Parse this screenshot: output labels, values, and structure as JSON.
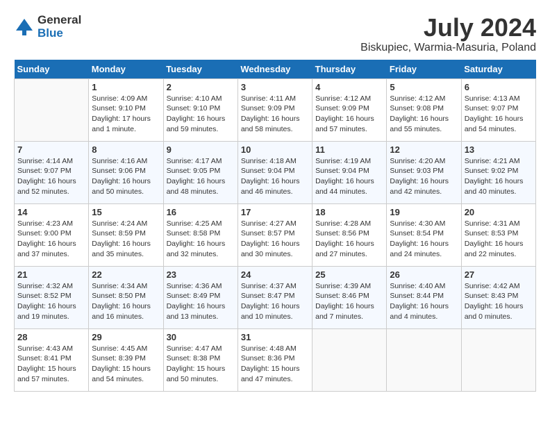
{
  "logo": {
    "text_general": "General",
    "text_blue": "Blue"
  },
  "title": "July 2024",
  "subtitle": "Biskupiec, Warmia-Masuria, Poland",
  "days_header": [
    "Sunday",
    "Monday",
    "Tuesday",
    "Wednesday",
    "Thursday",
    "Friday",
    "Saturday"
  ],
  "weeks": [
    [
      {
        "num": "",
        "info": ""
      },
      {
        "num": "1",
        "info": "Sunrise: 4:09 AM\nSunset: 9:10 PM\nDaylight: 17 hours\nand 1 minute."
      },
      {
        "num": "2",
        "info": "Sunrise: 4:10 AM\nSunset: 9:10 PM\nDaylight: 16 hours\nand 59 minutes."
      },
      {
        "num": "3",
        "info": "Sunrise: 4:11 AM\nSunset: 9:09 PM\nDaylight: 16 hours\nand 58 minutes."
      },
      {
        "num": "4",
        "info": "Sunrise: 4:12 AM\nSunset: 9:09 PM\nDaylight: 16 hours\nand 57 minutes."
      },
      {
        "num": "5",
        "info": "Sunrise: 4:12 AM\nSunset: 9:08 PM\nDaylight: 16 hours\nand 55 minutes."
      },
      {
        "num": "6",
        "info": "Sunrise: 4:13 AM\nSunset: 9:07 PM\nDaylight: 16 hours\nand 54 minutes."
      }
    ],
    [
      {
        "num": "7",
        "info": "Sunrise: 4:14 AM\nSunset: 9:07 PM\nDaylight: 16 hours\nand 52 minutes."
      },
      {
        "num": "8",
        "info": "Sunrise: 4:16 AM\nSunset: 9:06 PM\nDaylight: 16 hours\nand 50 minutes."
      },
      {
        "num": "9",
        "info": "Sunrise: 4:17 AM\nSunset: 9:05 PM\nDaylight: 16 hours\nand 48 minutes."
      },
      {
        "num": "10",
        "info": "Sunrise: 4:18 AM\nSunset: 9:04 PM\nDaylight: 16 hours\nand 46 minutes."
      },
      {
        "num": "11",
        "info": "Sunrise: 4:19 AM\nSunset: 9:04 PM\nDaylight: 16 hours\nand 44 minutes."
      },
      {
        "num": "12",
        "info": "Sunrise: 4:20 AM\nSunset: 9:03 PM\nDaylight: 16 hours\nand 42 minutes."
      },
      {
        "num": "13",
        "info": "Sunrise: 4:21 AM\nSunset: 9:02 PM\nDaylight: 16 hours\nand 40 minutes."
      }
    ],
    [
      {
        "num": "14",
        "info": "Sunrise: 4:23 AM\nSunset: 9:00 PM\nDaylight: 16 hours\nand 37 minutes."
      },
      {
        "num": "15",
        "info": "Sunrise: 4:24 AM\nSunset: 8:59 PM\nDaylight: 16 hours\nand 35 minutes."
      },
      {
        "num": "16",
        "info": "Sunrise: 4:25 AM\nSunset: 8:58 PM\nDaylight: 16 hours\nand 32 minutes."
      },
      {
        "num": "17",
        "info": "Sunrise: 4:27 AM\nSunset: 8:57 PM\nDaylight: 16 hours\nand 30 minutes."
      },
      {
        "num": "18",
        "info": "Sunrise: 4:28 AM\nSunset: 8:56 PM\nDaylight: 16 hours\nand 27 minutes."
      },
      {
        "num": "19",
        "info": "Sunrise: 4:30 AM\nSunset: 8:54 PM\nDaylight: 16 hours\nand 24 minutes."
      },
      {
        "num": "20",
        "info": "Sunrise: 4:31 AM\nSunset: 8:53 PM\nDaylight: 16 hours\nand 22 minutes."
      }
    ],
    [
      {
        "num": "21",
        "info": "Sunrise: 4:32 AM\nSunset: 8:52 PM\nDaylight: 16 hours\nand 19 minutes."
      },
      {
        "num": "22",
        "info": "Sunrise: 4:34 AM\nSunset: 8:50 PM\nDaylight: 16 hours\nand 16 minutes."
      },
      {
        "num": "23",
        "info": "Sunrise: 4:36 AM\nSunset: 8:49 PM\nDaylight: 16 hours\nand 13 minutes."
      },
      {
        "num": "24",
        "info": "Sunrise: 4:37 AM\nSunset: 8:47 PM\nDaylight: 16 hours\nand 10 minutes."
      },
      {
        "num": "25",
        "info": "Sunrise: 4:39 AM\nSunset: 8:46 PM\nDaylight: 16 hours\nand 7 minutes."
      },
      {
        "num": "26",
        "info": "Sunrise: 4:40 AM\nSunset: 8:44 PM\nDaylight: 16 hours\nand 4 minutes."
      },
      {
        "num": "27",
        "info": "Sunrise: 4:42 AM\nSunset: 8:43 PM\nDaylight: 16 hours\nand 0 minutes."
      }
    ],
    [
      {
        "num": "28",
        "info": "Sunrise: 4:43 AM\nSunset: 8:41 PM\nDaylight: 15 hours\nand 57 minutes."
      },
      {
        "num": "29",
        "info": "Sunrise: 4:45 AM\nSunset: 8:39 PM\nDaylight: 15 hours\nand 54 minutes."
      },
      {
        "num": "30",
        "info": "Sunrise: 4:47 AM\nSunset: 8:38 PM\nDaylight: 15 hours\nand 50 minutes."
      },
      {
        "num": "31",
        "info": "Sunrise: 4:48 AM\nSunset: 8:36 PM\nDaylight: 15 hours\nand 47 minutes."
      },
      {
        "num": "",
        "info": ""
      },
      {
        "num": "",
        "info": ""
      },
      {
        "num": "",
        "info": ""
      }
    ]
  ]
}
